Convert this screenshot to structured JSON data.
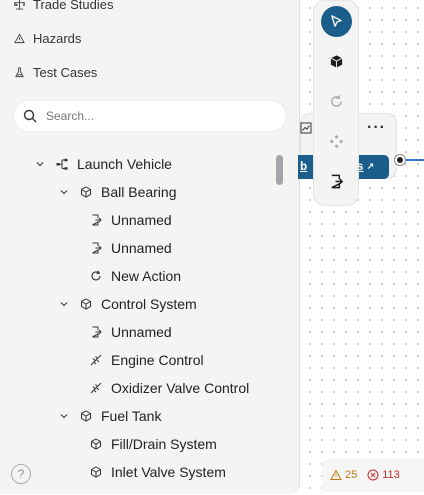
{
  "nav": {
    "items": [
      {
        "label": "Trade Studies",
        "icon": "scale-icon"
      },
      {
        "label": "Hazards",
        "icon": "warning-icon"
      },
      {
        "label": "Test Cases",
        "icon": "flask-icon"
      }
    ]
  },
  "search": {
    "placeholder": "Search..."
  },
  "tree": {
    "root": "Launch Vehicle",
    "groups": [
      {
        "label": "Ball Bearing",
        "children": [
          {
            "label": "Unnamed",
            "icon": "port-icon"
          },
          {
            "label": "Unnamed",
            "icon": "port-icon"
          },
          {
            "label": "New Action",
            "icon": "action-icon"
          }
        ]
      },
      {
        "label": "Control System",
        "children": [
          {
            "label": "Unnamed",
            "icon": "port-icon"
          },
          {
            "label": "Engine Control",
            "icon": "function-icon"
          },
          {
            "label": "Oxidizer Valve Control",
            "icon": "function-icon"
          }
        ]
      },
      {
        "label": "Fuel Tank",
        "children": [
          {
            "label": "Fill/Drain System",
            "icon": "cube-icon"
          },
          {
            "label": "Inlet Valve System",
            "icon": "cube-icon"
          }
        ]
      }
    ]
  },
  "help": {
    "label": "?"
  },
  "canvas": {
    "node_chip_lead": "b",
    "node_chip_text": "ts",
    "node_chip_mark": "↗"
  },
  "status": {
    "warnings": "25",
    "errors": "113"
  },
  "colors": {
    "accent": "#1b5e8c",
    "edge": "#3a6fd0",
    "warning": "#c07a09",
    "error": "#c42b2b"
  }
}
